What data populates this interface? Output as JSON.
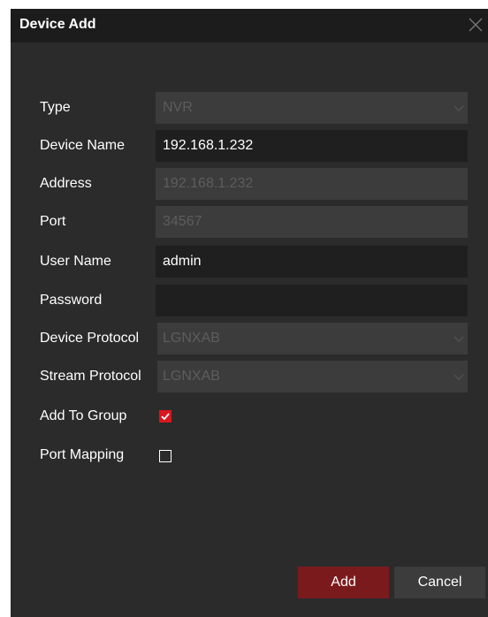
{
  "dialog": {
    "title": "Device Add",
    "close_icon": "close-icon"
  },
  "form": {
    "type": {
      "label": "Type",
      "value": "NVR"
    },
    "device_name": {
      "label": "Device Name",
      "value": "192.168.1.232"
    },
    "address": {
      "label": "Address",
      "value": "192.168.1.232"
    },
    "port": {
      "label": "Port",
      "value": "34567"
    },
    "user_name": {
      "label": "User Name",
      "value": "admin"
    },
    "password": {
      "label": "Password",
      "value": ""
    },
    "device_protocol": {
      "label": "Device Protocol",
      "value": "LGNXAB"
    },
    "stream_protocol": {
      "label": "Stream Protocol",
      "value": "LGNXAB"
    },
    "add_to_group": {
      "label": "Add To Group",
      "checked": true
    },
    "port_mapping": {
      "label": "Port Mapping",
      "checked": false
    }
  },
  "buttons": {
    "add": "Add",
    "cancel": "Cancel"
  },
  "colors": {
    "dialog_bg": "#2b2b2b",
    "titlebar_bg": "#1c1c1c",
    "input_bg": "#1f1f1f",
    "disabled_bg": "#3c3c3c",
    "disabled_text": "#5d5d5d",
    "accent": "#d9161e",
    "add_button": "#7b1a1d"
  }
}
